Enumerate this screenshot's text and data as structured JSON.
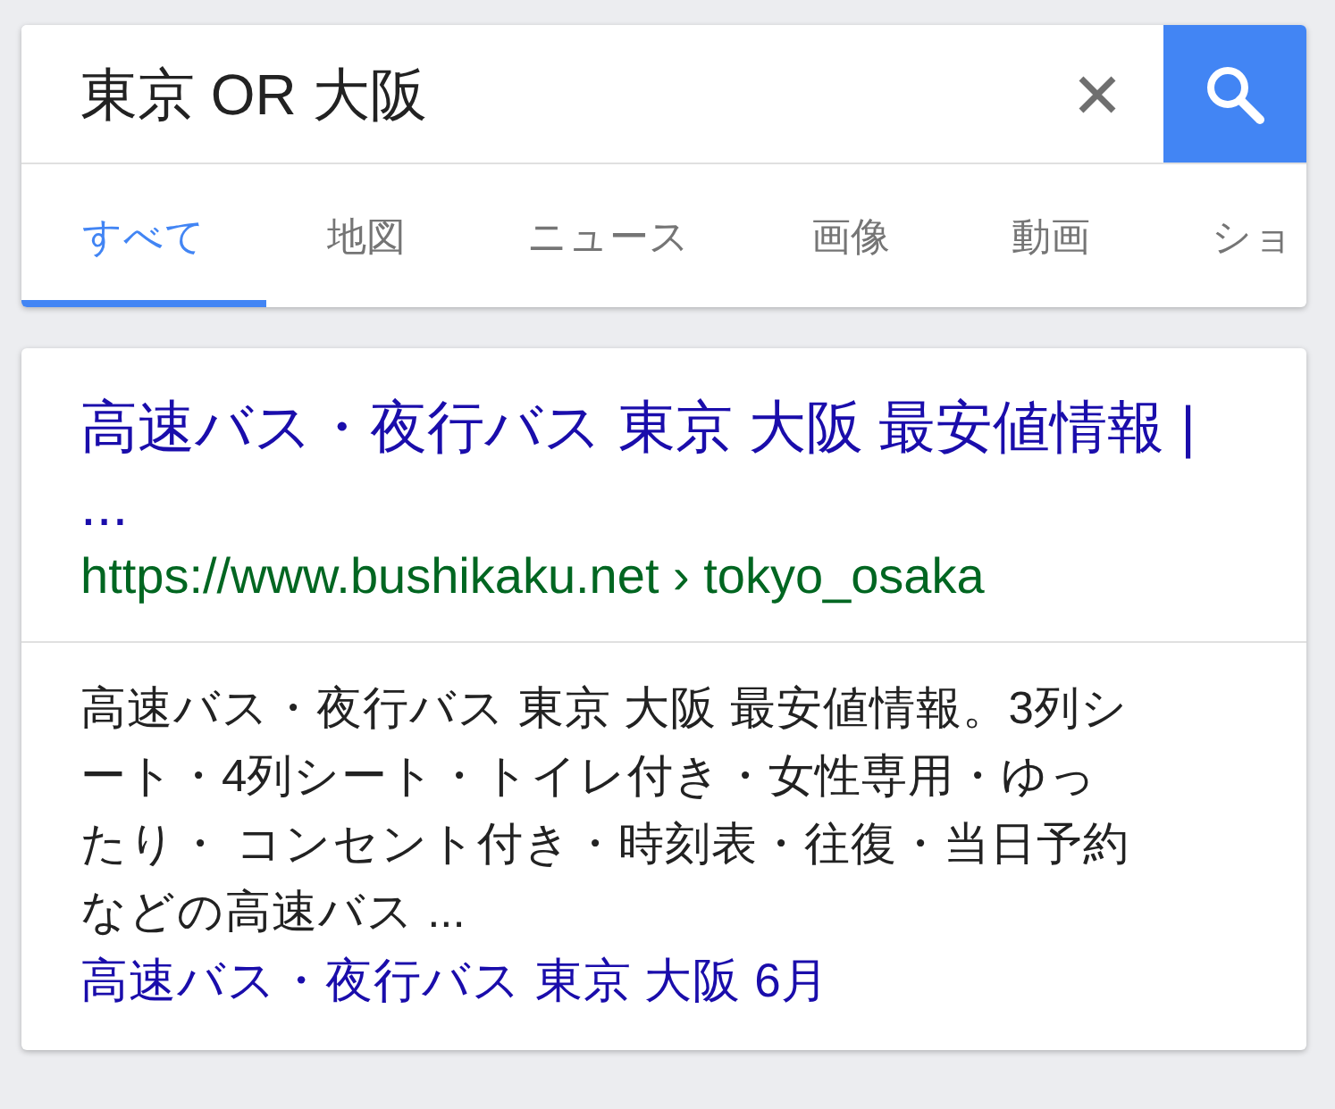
{
  "search": {
    "query": "東京 OR 大阪"
  },
  "tabs": [
    {
      "label": "すべて",
      "selected": true
    },
    {
      "label": "地図",
      "selected": false
    },
    {
      "label": "ニュース",
      "selected": false
    },
    {
      "label": "画像",
      "selected": false
    },
    {
      "label": "動画",
      "selected": false
    },
    {
      "label": "ショ",
      "selected": false
    }
  ],
  "results": [
    {
      "title": "高速バス・夜行バス 東京 大阪 最安値情報 | ...",
      "url": "https://www.bushikaku.net › tokyo_osaka",
      "snippet": "高速バス・夜行バス 東京 大阪 最安値情報。3列シート・4列シート・トイレ付き・女性専用・ゆったり・ コンセント付き・時刻表・往復・当日予約などの高速バス ...",
      "sitelinks": [
        "高速バス・夜行バス 東京 大阪 6月"
      ]
    }
  ]
}
